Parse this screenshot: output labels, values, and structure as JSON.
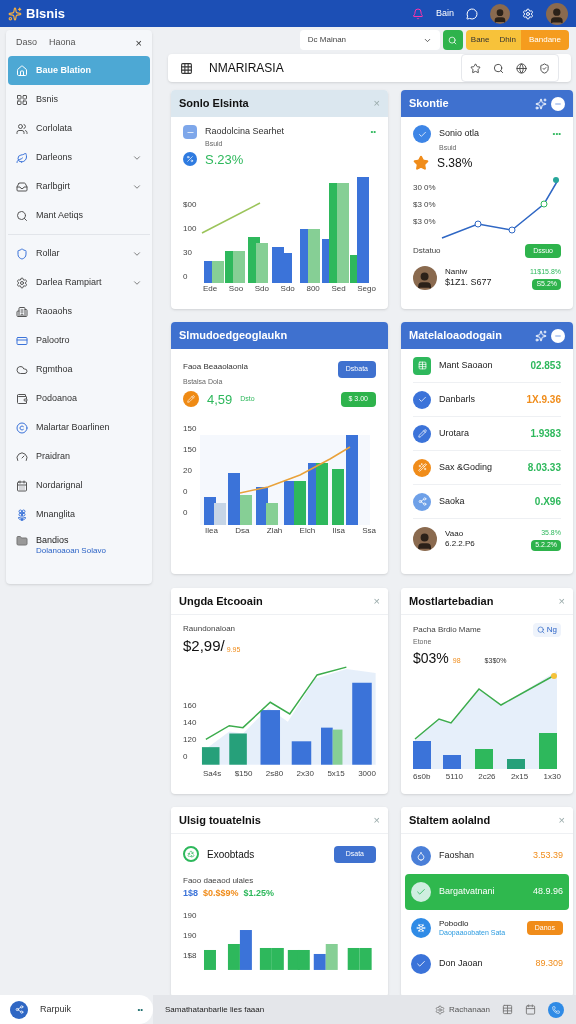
{
  "topbar": {
    "brand": "Blsnis",
    "user_label": "Bain"
  },
  "sidebar": {
    "header": [
      "Daso",
      "Haona"
    ],
    "close": "×",
    "items": [
      {
        "label": "Baue Blation",
        "selected": true,
        "has_submenu": false
      },
      {
        "label": "Bsnis",
        "selected": false,
        "has_submenu": false
      },
      {
        "label": "Corlolata",
        "selected": false,
        "has_submenu": false
      },
      {
        "label": "Darleons",
        "selected": false,
        "has_submenu": true
      },
      {
        "label": "Rarlbgirt",
        "selected": false,
        "has_submenu": true
      },
      {
        "label": "Mant Aetiqs",
        "selected": false,
        "has_submenu": false
      },
      {
        "label": "Rollar",
        "selected": false,
        "has_submenu": true
      },
      {
        "label": "Darlea Rampiart",
        "selected": false,
        "has_submenu": true
      },
      {
        "label": "Raoaohs",
        "selected": false,
        "has_submenu": false
      },
      {
        "label": "Palootro",
        "selected": false,
        "has_submenu": false
      },
      {
        "label": "Rgmthoa",
        "selected": false,
        "has_submenu": false
      },
      {
        "label": "Podoanoa",
        "selected": false,
        "has_submenu": false
      },
      {
        "label": "Malartar Boarlinen",
        "selected": false,
        "has_submenu": false
      },
      {
        "label": "Praidran",
        "selected": false,
        "has_submenu": false
      },
      {
        "label": "Nordarignal",
        "selected": false,
        "has_submenu": false
      },
      {
        "label": "Mnanglita",
        "selected": false,
        "has_submenu": false
      }
    ],
    "footer_item": {
      "title": "Bandios",
      "subtitle": "Dolanoaoan Solavo"
    }
  },
  "search": {
    "value": "Dc Mainan"
  },
  "segments": [
    {
      "label": "Bane",
      "selected": false
    },
    {
      "label": "Dhin",
      "selected": false
    },
    {
      "label": "Bandane",
      "selected": true
    }
  ],
  "page_title": "NMARIRASIA",
  "card_sales": {
    "title": "Sonlo Elsinta",
    "close": "×",
    "subtitle": "Raodolcina Searhet",
    "more": "••",
    "caption": "Bsuid",
    "value": "S.23%",
    "yticks": [
      "$00",
      "100",
      "30",
      "0"
    ],
    "xlabels": [
      "Ede",
      "Soo",
      "Sdo",
      "Sdo",
      "800",
      "Sed",
      "Sego"
    ]
  },
  "card_stats": {
    "title": "Skontie",
    "subtitle": "Sonio otla",
    "more": "•••",
    "caption": "Bsuid",
    "value": "S.38%",
    "yticks": [
      "30 0%",
      "$3 0%",
      "$3 0%"
    ],
    "status": "Dstatuo",
    "badge": "Dssuo",
    "person": {
      "name": "Naniw",
      "amount": "$1Z1. S677",
      "change": "11$15.8%",
      "badge": "S5.2%"
    }
  },
  "card_summary": {
    "title": "Slmudoedgeoglaukn",
    "subtitle": "Faoa Beaaolaonla",
    "button": "Dsbata",
    "caption": "Bstalsa Dola",
    "value": "4,59",
    "unit": "Dsto",
    "badge": "$ 3.00",
    "yticks": [
      "150",
      "150",
      "20",
      "0",
      "0"
    ],
    "xlabels": [
      "Ilea",
      "Dsa",
      "Zlah",
      "Elch",
      "Ilsa",
      "Ssa"
    ]
  },
  "card_list": {
    "title": "Matelaloaodogain",
    "rows": [
      {
        "label": "Mant Saoaon",
        "value": "02.853",
        "color": "#2eb85c"
      },
      {
        "label": "Danbarls",
        "value": "1X.9.36",
        "color": "#f08c1a"
      },
      {
        "label": "Urotara",
        "value": "1.9383",
        "color": "#2eb85c"
      },
      {
        "label": "Sax &Goding",
        "value": "8.03.33",
        "color": "#2eb85c"
      },
      {
        "label": "Saoka",
        "value": "0.X96",
        "color": "#2eb85c"
      }
    ],
    "person": {
      "name": "Vaao",
      "amount": "6.2.2.P6",
      "change": "35.8%",
      "badge": "5.2.2%"
    }
  },
  "card_growth": {
    "title": "Ungda Etcooain",
    "close": "×",
    "caption": "Raundonaloan",
    "value": "$2,99/",
    "unit": "9.95",
    "yticks": [
      "160",
      "140",
      "120",
      "0"
    ],
    "xlabels": [
      "Sa4s",
      "$150",
      "2s80",
      "2x30",
      "5x15",
      "3000"
    ]
  },
  "card_market": {
    "title": "Mostlartebadian",
    "close": "×",
    "subtitle": "Pacha Brdio Mame",
    "chip": "Ng",
    "caption": "Etone",
    "value": "$03%",
    "unit": "98",
    "note": "$3$0%",
    "xlabels": [
      "6s0b",
      "5110",
      "2c26",
      "2x15",
      "1x30"
    ]
  },
  "card_usage": {
    "title": "Ulsig touatelnis",
    "close": "×",
    "subtitle": "Exoobtads",
    "button": "Dsata",
    "caption": "Faoo daeaod ulales",
    "figures": [
      {
        "text": "1$8",
        "color": "#3b73d9"
      },
      {
        "text": "$0.$$9%",
        "color": "#f08c1a"
      },
      {
        "text": "$1.25%",
        "color": "#2eb85c"
      }
    ],
    "yticks": [
      "190",
      "190",
      "1$8"
    ]
  },
  "card_system": {
    "title": "Staltem aolalnd",
    "close": "×",
    "rows": [
      {
        "kind": "value",
        "label": "Faoshan",
        "value": "3.53.39",
        "selected": false
      },
      {
        "kind": "value",
        "label": "Bargatvatnani",
        "value": "48.9.96",
        "selected": true
      },
      {
        "kind": "action",
        "label": "Pobodlo",
        "sublabel": "Daopaaoobaten Sata",
        "value": "Danos",
        "selected": false
      },
      {
        "kind": "value",
        "label": "Don Jaoan",
        "value": "89.309",
        "selected": false
      }
    ]
  },
  "bottom": {
    "pill": "Rarpuik",
    "pill_more": "••",
    "status": "Samathatanbarlie lies faaan",
    "right_label": "Rachanaan"
  }
}
